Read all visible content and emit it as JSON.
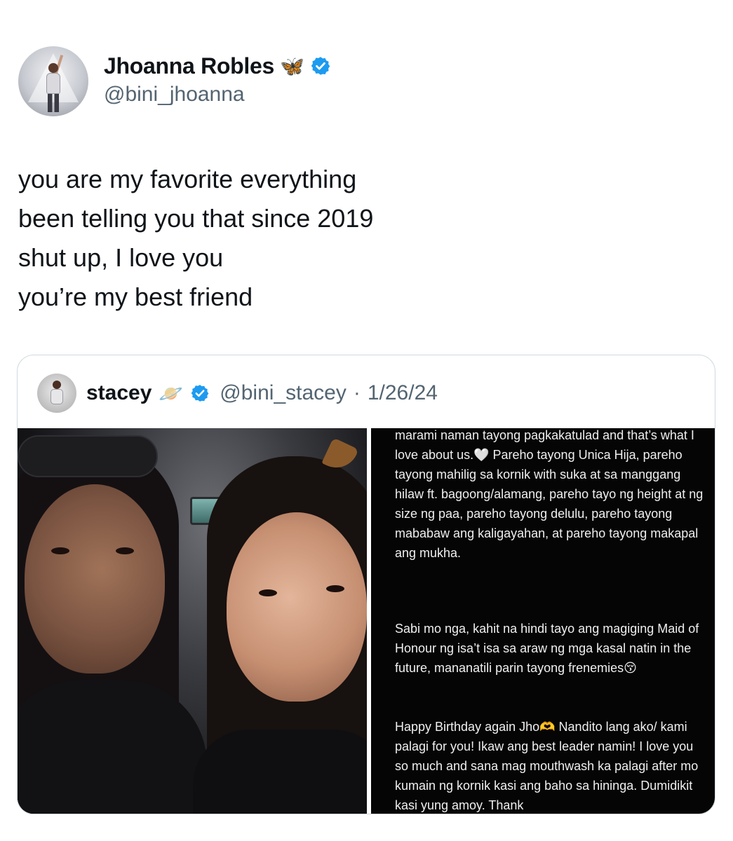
{
  "tweet": {
    "author": {
      "display_name": "Jhoanna Robles",
      "name_emoji": "🦋",
      "handle": "@bini_jhoanna",
      "verified": true
    },
    "text_lines": [
      "you are my favorite everything",
      "been telling you that since 2019",
      "shut up, I love you",
      "you’re my best friend"
    ]
  },
  "quote": {
    "author": {
      "display_name": "stacey",
      "name_emoji": "🪐",
      "handle": "@bini_stacey",
      "separator": "·",
      "date": "1/26/24",
      "verified": true
    },
    "note": {
      "paragraph_1": "marami naman tayong pagkakatulad and that’s what I love about us.🤍 Pareho tayong Unica Hija, pareho tayong mahilig sa kornik with suka at sa manggang hilaw ft. bagoong/alamang, pareho tayo ng height at ng size ng paa, pareho tayong delulu, pareho tayong mababaw ang kaligayahan, at pareho tayong makapal ang mukha.",
      "paragraph_2": "Sabi mo nga, kahit na hindi tayo ang magiging Maid of Honour ng isa’t isa sa araw ng mga kasal natin in the future, mananatili parin tayong frenemies😚",
      "paragraph_3": "Happy Birthday again Jho🫶 Nandito lang ako/ kami palagi for you! Ikaw ang best leader namin! I love you so much and sana mag mouthwash ka palagi after mo kumain ng kornik kasi ang baho sa hininga. Dumidikit kasi yung amoy. Thank"
    }
  },
  "colors": {
    "text_primary": "#0f1419",
    "text_secondary": "#536471",
    "verified_blue": "#1d9bf0",
    "border": "#cfd9de",
    "note_background": "#050505"
  }
}
